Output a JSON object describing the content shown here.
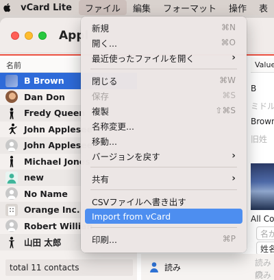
{
  "menubar": {
    "app_name": "vCard Lite",
    "items": [
      "ファイル",
      "編集",
      "フォーマット",
      "操作",
      "表"
    ]
  },
  "window": {
    "title": "Appl"
  },
  "contacts": {
    "column_header": "名前",
    "items": [
      {
        "name": "B Brown",
        "avatar": "photo-icon",
        "selected": true
      },
      {
        "name": "Dan Don",
        "avatar": "face-photo-icon"
      },
      {
        "name": "Fredy Queen",
        "avatar": "silhouette-icon"
      },
      {
        "name": "John Applesee",
        "avatar": "runner-silhouette-icon"
      },
      {
        "name": "John Applesee",
        "avatar": "person-placeholder-icon"
      },
      {
        "name": "Michael Jones",
        "avatar": "silhouette-icon"
      },
      {
        "name": "new",
        "avatar": "person-teal-icon"
      },
      {
        "name": "No Name",
        "avatar": "person-placeholder-icon"
      },
      {
        "name": "Orange Inc.",
        "avatar": "building-icon"
      },
      {
        "name": "Robert Willian",
        "avatar": "person-placeholder-icon"
      },
      {
        "name": "山田 太郎",
        "avatar": "silhouette-icon"
      }
    ],
    "total": "total 11 contacts"
  },
  "detail": {
    "column_header": "Value",
    "values": [
      {
        "text": "B",
        "gray": false
      },
      {
        "text": "ミドル",
        "gray": true
      },
      {
        "text": "Brown",
        "gray": false
      },
      {
        "text": "旧姓",
        "gray": true
      }
    ],
    "all_contacts": "All Co",
    "given_placeholder": "名が",
    "family_field": "姓名",
    "read_label": "読み",
    "read_value_1": "読みの",
    "read_value_2": "読みの"
  },
  "file_menu": {
    "items": [
      {
        "label": "新規",
        "shortcut": "⌘N"
      },
      {
        "label": "開く...",
        "shortcut": "⌘O"
      },
      {
        "label": "最近使ったファイルを開く",
        "submenu": true
      },
      {
        "separator": true
      },
      {
        "label": "閉じる",
        "shortcut": "⌘W"
      },
      {
        "label": "保存",
        "shortcut": "⌘S",
        "disabled": true
      },
      {
        "label": "複製",
        "shortcut": "⇧⌘S"
      },
      {
        "label": "名称変更..."
      },
      {
        "label": "移動..."
      },
      {
        "label": "バージョンを戻す",
        "submenu": true
      },
      {
        "separator": true
      },
      {
        "label": "共有",
        "submenu": true
      },
      {
        "separator": true
      },
      {
        "label": "CSVファイルへ書き出す"
      },
      {
        "label": "Import from vCard",
        "highlight": true
      },
      {
        "separator": true
      },
      {
        "label": "印刷...",
        "shortcut": "⌘P"
      }
    ]
  }
}
